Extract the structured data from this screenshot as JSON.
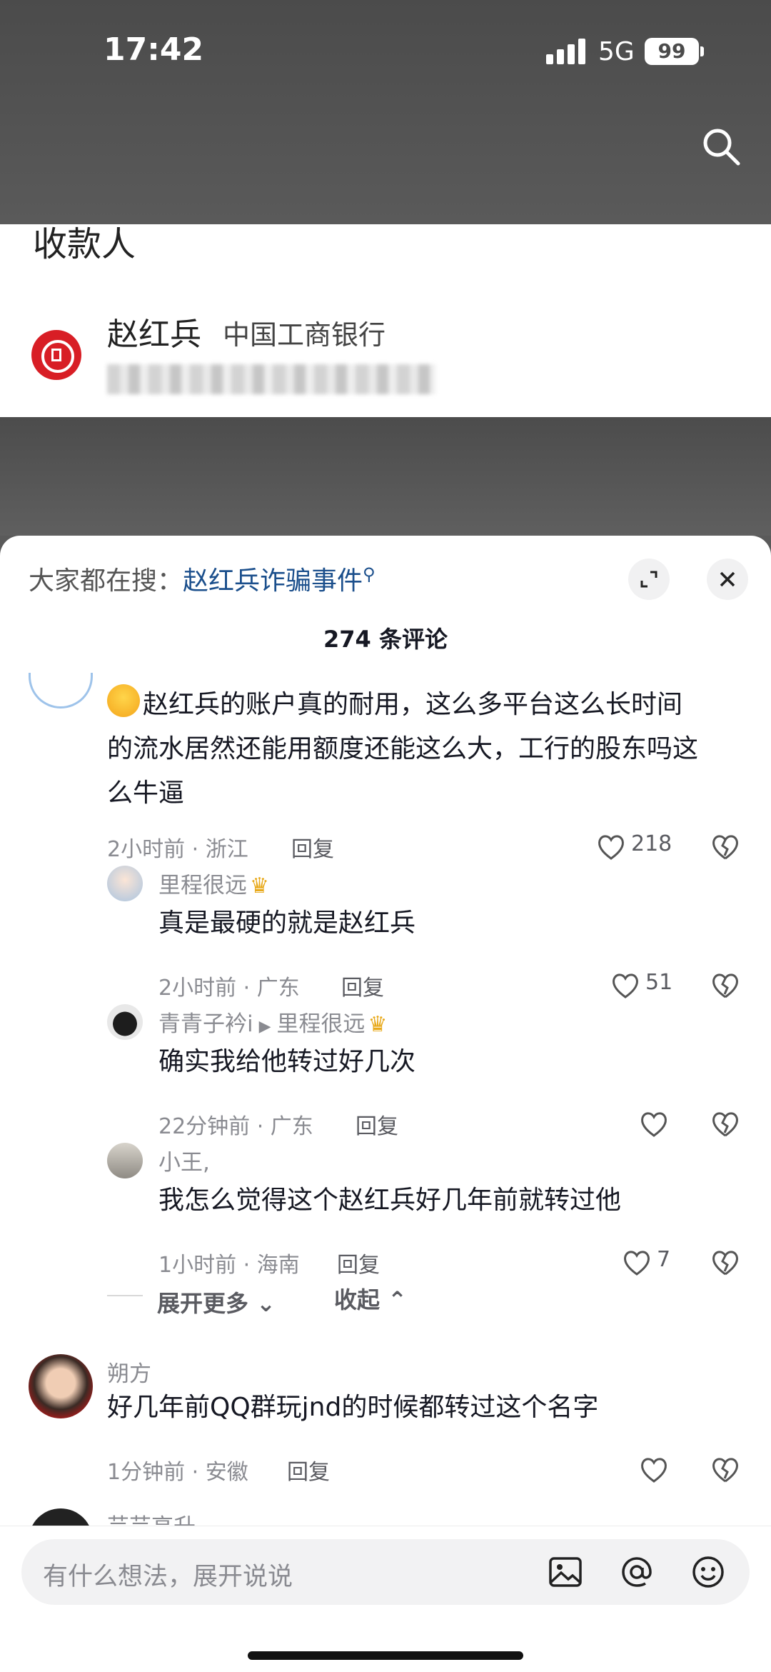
{
  "status_bar": {
    "time": "17:42",
    "network": "5G",
    "battery": "99"
  },
  "payee": {
    "title": "收款人",
    "name": "赵红兵",
    "bank": "中国工商银行"
  },
  "sheet": {
    "hot_search_prefix": "大家都在搜：",
    "hot_search_link": "赵红兵诈骗事件",
    "comment_count": "274 条评论"
  },
  "comments": [
    {
      "text_line1": "赵红兵的账户真的耐用，这么多平台这么长时间",
      "text_line2": "的流水居然还能用额度还能这么大，工行的股东吗这",
      "text_line3": "么牛逼",
      "meta": "2小时前 · 浙江",
      "reply": "回复",
      "likes": "218"
    },
    {
      "user": "里程很远",
      "text": "真是最硬的就是赵红兵",
      "meta": "2小时前 · 广东",
      "reply": "回复",
      "likes": "51"
    },
    {
      "user": "青青子衿i",
      "reply_to": "里程很远",
      "text": "确实我给他转过好几次",
      "meta": "22分钟前 · 广东",
      "reply": "回复"
    },
    {
      "user": "小王,",
      "text": "我怎么觉得这个赵红兵好几年前就转过他",
      "meta": "1小时前 · 海南",
      "reply": "回复",
      "likes": "7"
    },
    {
      "user": "朔方",
      "text": "好几年前QQ群玩jnd的时候都转过这个名字",
      "meta": "1分钟前 · 安徽",
      "reply": "回复"
    }
  ],
  "expand_more": "展开更多",
  "collapse": "收起",
  "partial_user": "芸芸高升",
  "input": {
    "placeholder": "有什么想法，展开说说"
  },
  "colors": {
    "link": "#1b4f8c",
    "bank_red": "#d81e25",
    "crown": "#e8a91a"
  }
}
